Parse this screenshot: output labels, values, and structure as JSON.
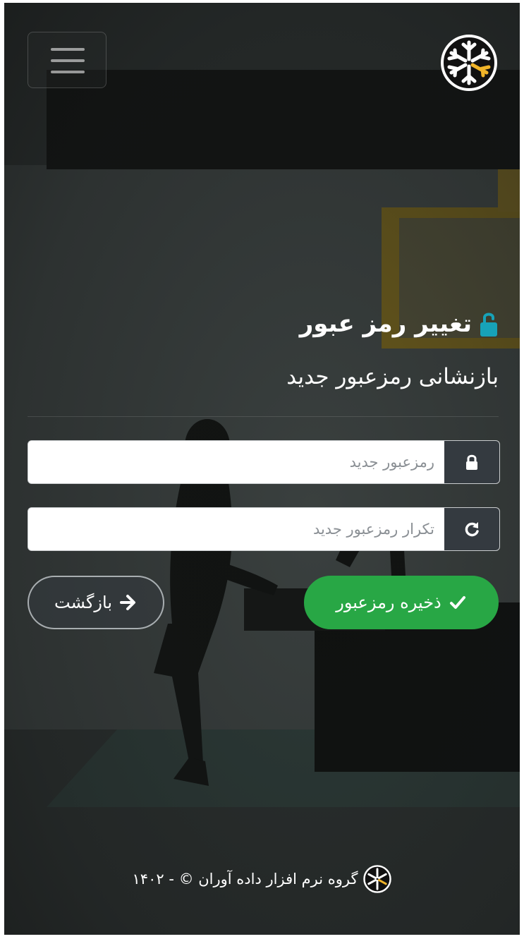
{
  "header": {
    "menu_icon": "hamburger-menu-icon",
    "logo_icon": "snowflake-logo-icon"
  },
  "page": {
    "title": "تغییر رمز عبور",
    "title_icon": "unlock-icon",
    "subtitle": "بازنشانی رمزعبور جدید"
  },
  "form": {
    "new_password": {
      "placeholder": "رمزعبور جدید",
      "value": "",
      "icon": "lock-icon"
    },
    "repeat_password": {
      "placeholder": "تکرار رمزعبور جدید",
      "value": "",
      "icon": "refresh-icon"
    },
    "save_label": "ذخیره رمزعبور",
    "save_icon": "check-icon",
    "back_label": "بازگشت",
    "back_icon": "arrow-right-icon"
  },
  "footer": {
    "text": "گروه نرم افزار داده آوران © - ۱۴۰۲",
    "logo_icon": "snowflake-logo-icon"
  },
  "colors": {
    "accent_green": "#28a745",
    "addon_dark": "#343a40",
    "lock_blue": "#17a2b8",
    "logo_gold": "#f0b429"
  }
}
